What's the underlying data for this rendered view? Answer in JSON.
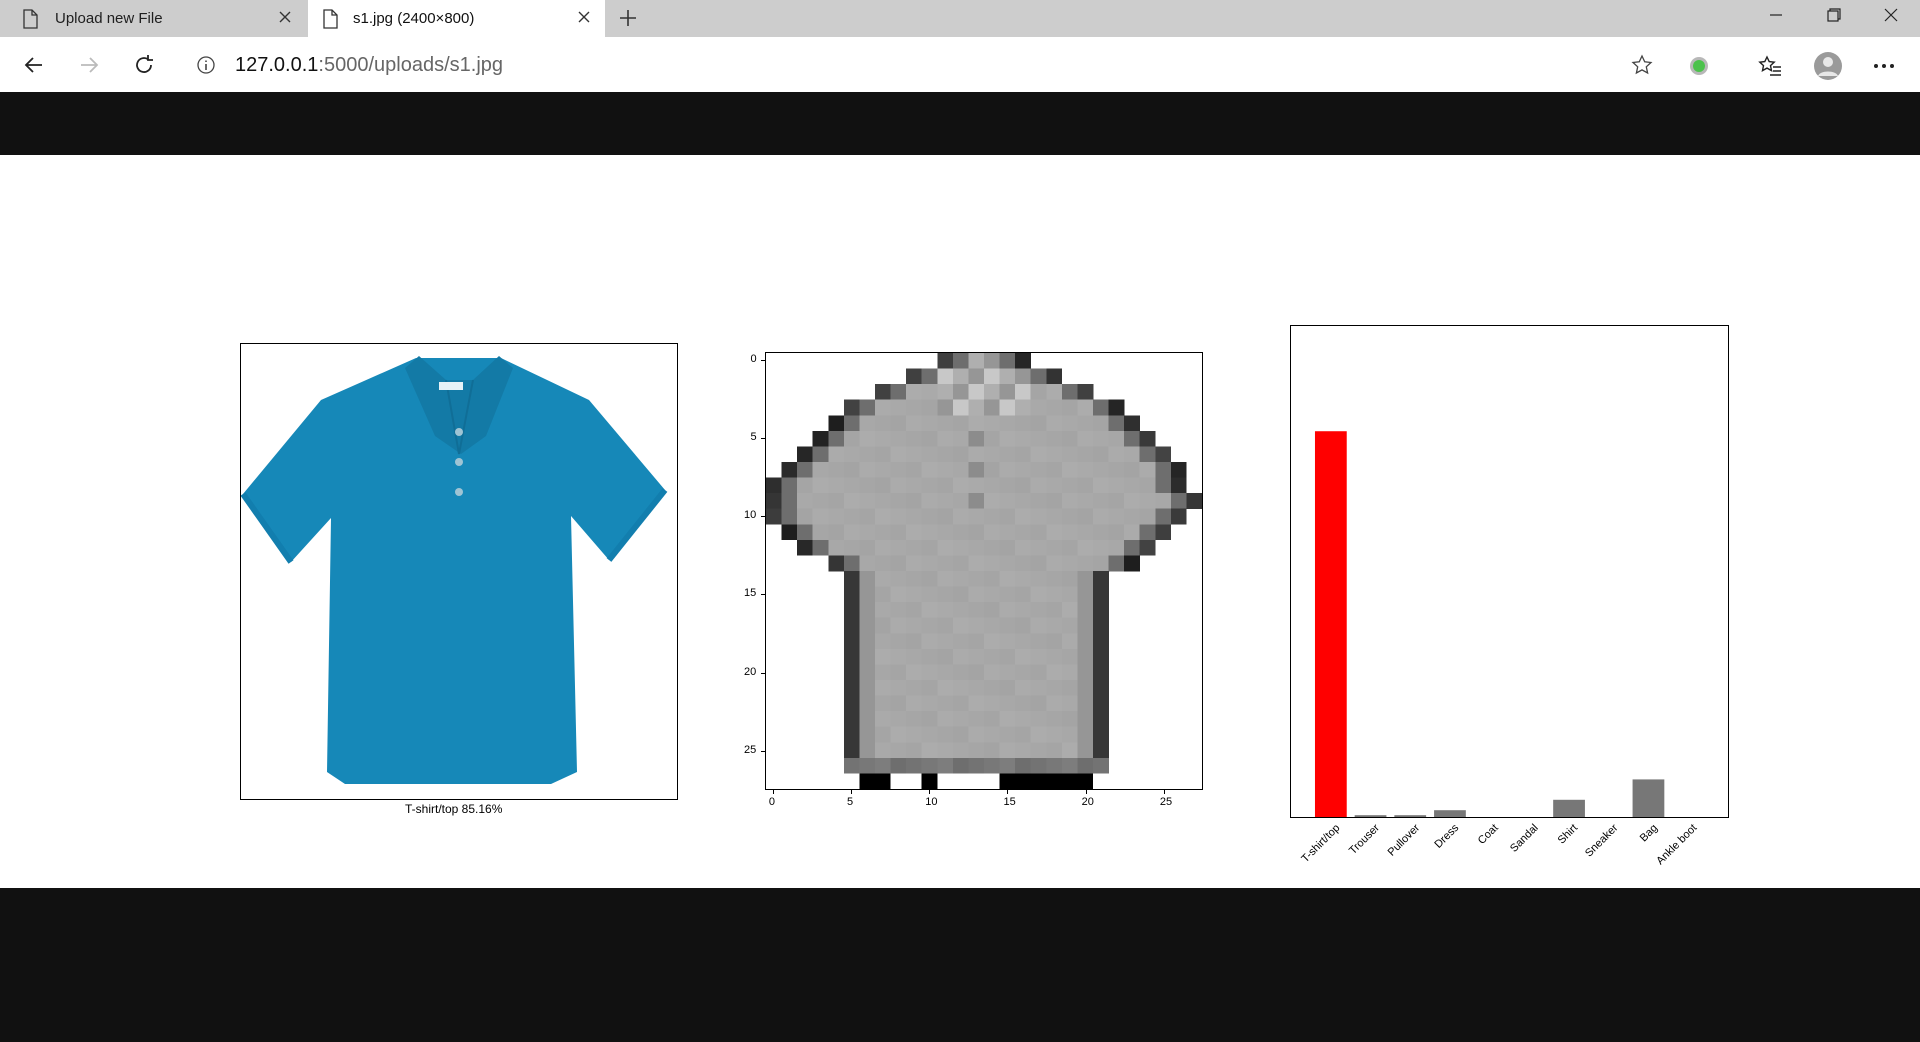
{
  "browser": {
    "tabs": [
      {
        "label": "Upload new File",
        "active": false
      },
      {
        "label": "s1.jpg (2400×800)",
        "active": true
      }
    ],
    "url_host": "127.0.0.1",
    "url_rest": ":5000/uploads/s1.jpg",
    "icons": [
      "page-icon",
      "close-icon",
      "plus-icon",
      "minimize-icon",
      "restore-icon",
      "close-window-icon",
      "back-icon",
      "forward-icon",
      "refresh-icon",
      "info-icon",
      "star-icon",
      "extension-icon",
      "favorites-icon",
      "profile-icon",
      "more-icon"
    ]
  },
  "figure": {
    "caption": "T-shirt/top 85.16%",
    "grid_image": {
      "size": 28,
      "x_ticks": [
        "0",
        "5",
        "10",
        "15",
        "20",
        "25"
      ],
      "y_ticks": [
        "0",
        "5",
        "10",
        "15",
        "20",
        "25"
      ]
    },
    "chart_data": {
      "type": "bar",
      "categories": [
        "T-shirt/top",
        "Trouser",
        "Pullover",
        "Dress",
        "Coat",
        "Sandal",
        "Shirt",
        "Sneaker",
        "Bag",
        "Ankle boot"
      ],
      "values": [
        0.8516,
        0.004,
        0.004,
        0.015,
        0.0,
        0.0,
        0.038,
        0.0,
        0.083,
        0.0
      ],
      "highlight_index": 0,
      "highlight_color": "#ff0000",
      "bar_color": "#777777",
      "ylim": [
        0,
        1
      ],
      "title": "",
      "xlabel": "",
      "ylabel": ""
    }
  }
}
